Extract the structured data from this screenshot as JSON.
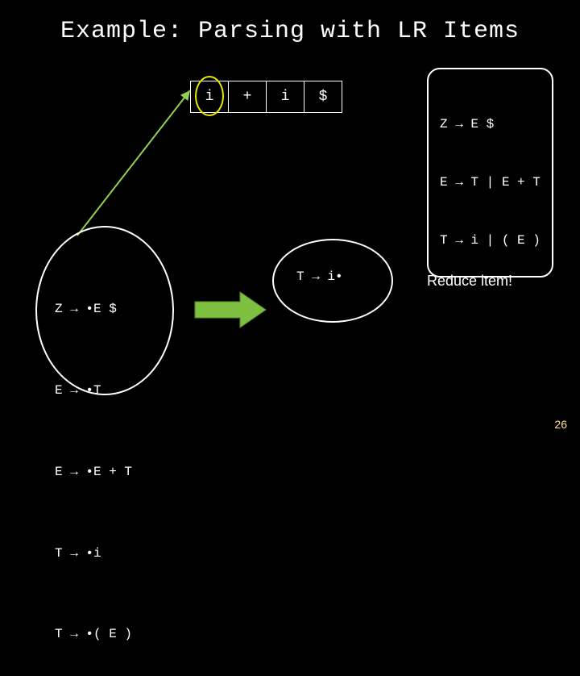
{
  "title": "Example: Parsing with LR Items",
  "tape": {
    "c0": "i",
    "c1": "+",
    "c2": "i",
    "c3": "$"
  },
  "grammar": {
    "l0": "Z → E $",
    "l1": "E → T | E + T",
    "l2": "T → i | ( E )"
  },
  "left_state": {
    "i0": "Z → •E $",
    "i1": "E → •T",
    "i2": "E → •E + T",
    "i3": "T → •i",
    "i4": "T → •( E )"
  },
  "right_state": {
    "item": "T → i•"
  },
  "note": "Reduce item!",
  "slide_number": "26",
  "chart_data": {
    "type": "table",
    "title": "LR Parsing Example",
    "input_tape": [
      "i",
      "+",
      "i",
      "$"
    ],
    "current_position": 0,
    "grammar_rules": [
      {
        "lhs": "Z",
        "rhs": "E $"
      },
      {
        "lhs": "E",
        "rhs": "T | E + T"
      },
      {
        "lhs": "T",
        "rhs": "i | ( E )"
      }
    ],
    "initial_state_items": [
      "Z → •E $",
      "E → •T",
      "E → •E + T",
      "T → •i",
      "T → •( E )"
    ],
    "next_state_items": [
      "T → i•"
    ],
    "action": "Reduce item"
  }
}
